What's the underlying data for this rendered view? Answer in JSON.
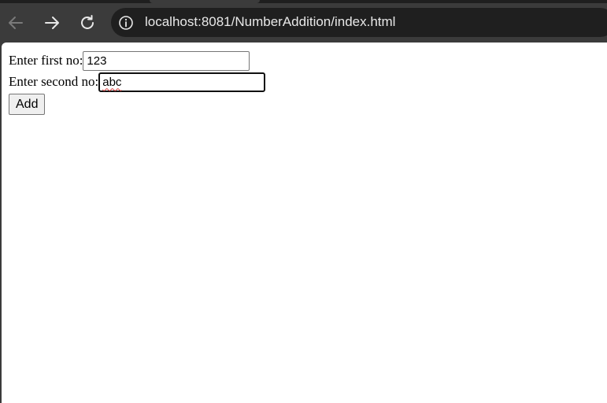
{
  "browser": {
    "url": "localhost:8081/NumberAddition/index.html",
    "icons": {
      "back": "arrow-left-icon",
      "forward": "arrow-right-icon",
      "reload": "reload-icon",
      "site_info": "info-icon"
    }
  },
  "form": {
    "first_label": "Enter first no:",
    "first_value": "123",
    "second_label": "Enter second no:",
    "second_value": "abc",
    "submit_label": "Add"
  }
}
